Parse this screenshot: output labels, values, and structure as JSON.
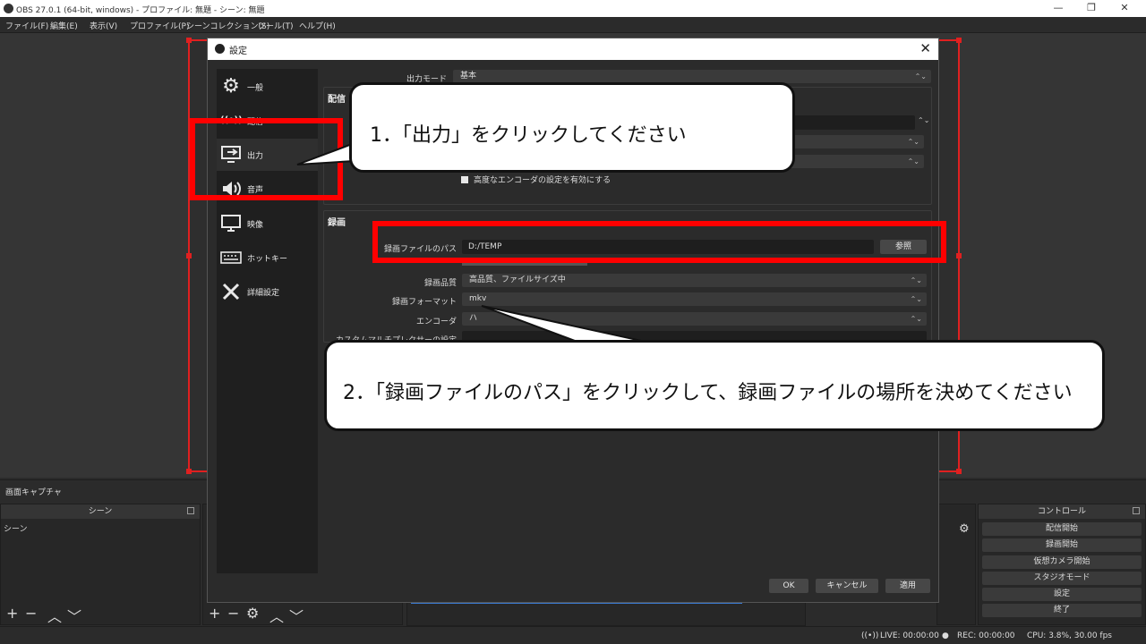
{
  "window": {
    "title": "OBS 27.0.1 (64-bit, windows) - プロファイル: 無題 - シーン: 無題",
    "minimize": "—",
    "maximize": "❐",
    "close": "✕"
  },
  "menu": [
    "ファイル(F)",
    "編集(E)",
    "表示(V)",
    "プロファイル(P)",
    "シーンコレクション(S)",
    "ツール(T)",
    "ヘルプ(H)"
  ],
  "preview_label": "画面キャプチャ",
  "scenes_dock": {
    "title": "シーン",
    "items": [
      "シーン"
    ]
  },
  "controls_dock": {
    "title": "コントロール",
    "buttons": [
      "配信開始",
      "録画開始",
      "仮想カメラ開始",
      "スタジオモード",
      "設定",
      "終了"
    ]
  },
  "status": {
    "live": "LIVE: 00:00:00",
    "rec": "REC: 00:00:00",
    "cpu": "CPU: 3.8%, 30.00 fps"
  },
  "settings": {
    "title": "設定",
    "close": "✕",
    "nav": [
      {
        "label": "一般",
        "icon": "gear-icon",
        "glyph": "⚙"
      },
      {
        "label": "配信",
        "icon": "broadcast-icon",
        "glyph": "((•))"
      },
      {
        "label": "出力",
        "icon": "output-monitor-icon",
        "glyph": "⇥"
      },
      {
        "label": "音声",
        "icon": "speaker-icon",
        "glyph": "🔊"
      },
      {
        "label": "映像",
        "icon": "monitor-icon",
        "glyph": "▭"
      },
      {
        "label": "ホットキー",
        "icon": "keyboard-icon",
        "glyph": "⌨"
      },
      {
        "label": "詳細設定",
        "icon": "tools-icon",
        "glyph": "✂"
      }
    ],
    "output_mode_label": "出力モード",
    "output_mode_value": "基本",
    "streaming_group": "配信",
    "advanced_encoder_checkbox": "高度なエンコーダの設定を有効にする",
    "recording_group": "録画",
    "rec_path_label": "録画ファイルのパス",
    "rec_path_value": "D:/TEMP",
    "browse_button": "参照",
    "rec_quality_label": "録画品質",
    "rec_quality_value": "高品質、ファイルサイズ中",
    "rec_format_label": "録画フォーマット",
    "rec_format_value": "mkv",
    "encoder_label": "エンコーダ",
    "encoder_value": "ハ",
    "muxer_label": "カスタムマルチプレクサーの設定",
    "ok": "OK",
    "cancel": "キャンセル",
    "apply": "適用"
  },
  "annotations": {
    "step1": "1．「出力」をクリックしてください",
    "step2": "2．「録画ファイルのパス」をクリックして、録画ファイルの場所を決めてください"
  }
}
